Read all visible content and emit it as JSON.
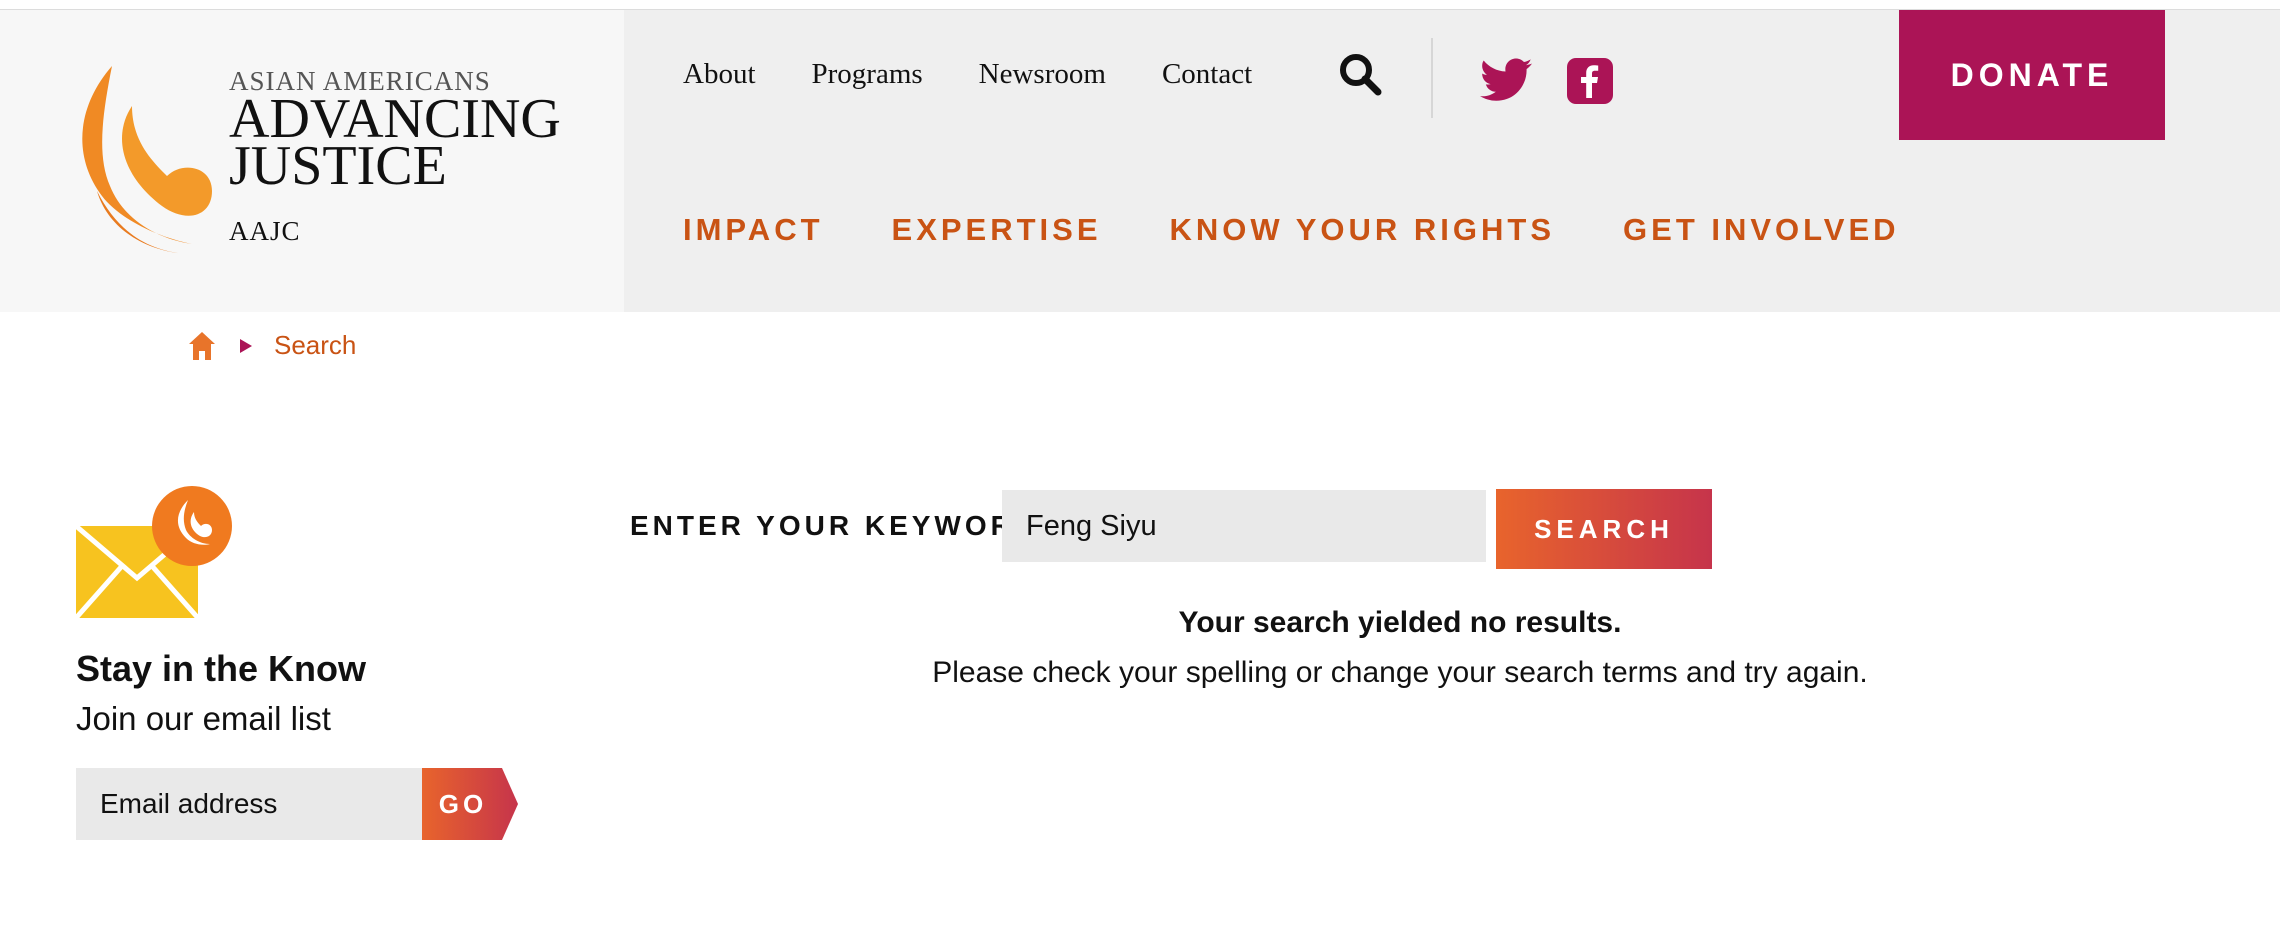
{
  "header": {
    "logo": {
      "line1": "ASIAN AMERICANS",
      "line2": "ADVANCING",
      "line3": "JUSTICE",
      "line4": "AAJC"
    },
    "utility_nav": [
      "About",
      "Programs",
      "Newsroom",
      "Contact"
    ],
    "donate_label": "DONATE",
    "main_nav": [
      "IMPACT",
      "EXPERTISE",
      "KNOW YOUR RIGHTS",
      "GET INVOLVED"
    ],
    "icons": [
      "search-icon",
      "twitter-icon",
      "facebook-icon"
    ]
  },
  "breadcrumb": {
    "home_icon": "home-icon",
    "current": "Search"
  },
  "sidebar": {
    "icon": "mail-icon",
    "title": "Stay in the Know",
    "subtitle": "Join our email list",
    "email_placeholder": "Email address",
    "go_label": "GO"
  },
  "search": {
    "label": "ENTER YOUR KEYWORDS",
    "value": "Feng Siyu",
    "button_label": "SEARCH",
    "no_results": "Your search yielded no results.",
    "hint": "Please check your spelling or change your search terms and try again."
  },
  "colors": {
    "brand_orange": "#c95314",
    "donate_magenta": "#ab1456",
    "social_magenta": "#ab1456",
    "flame_orange": "#f08a24"
  }
}
